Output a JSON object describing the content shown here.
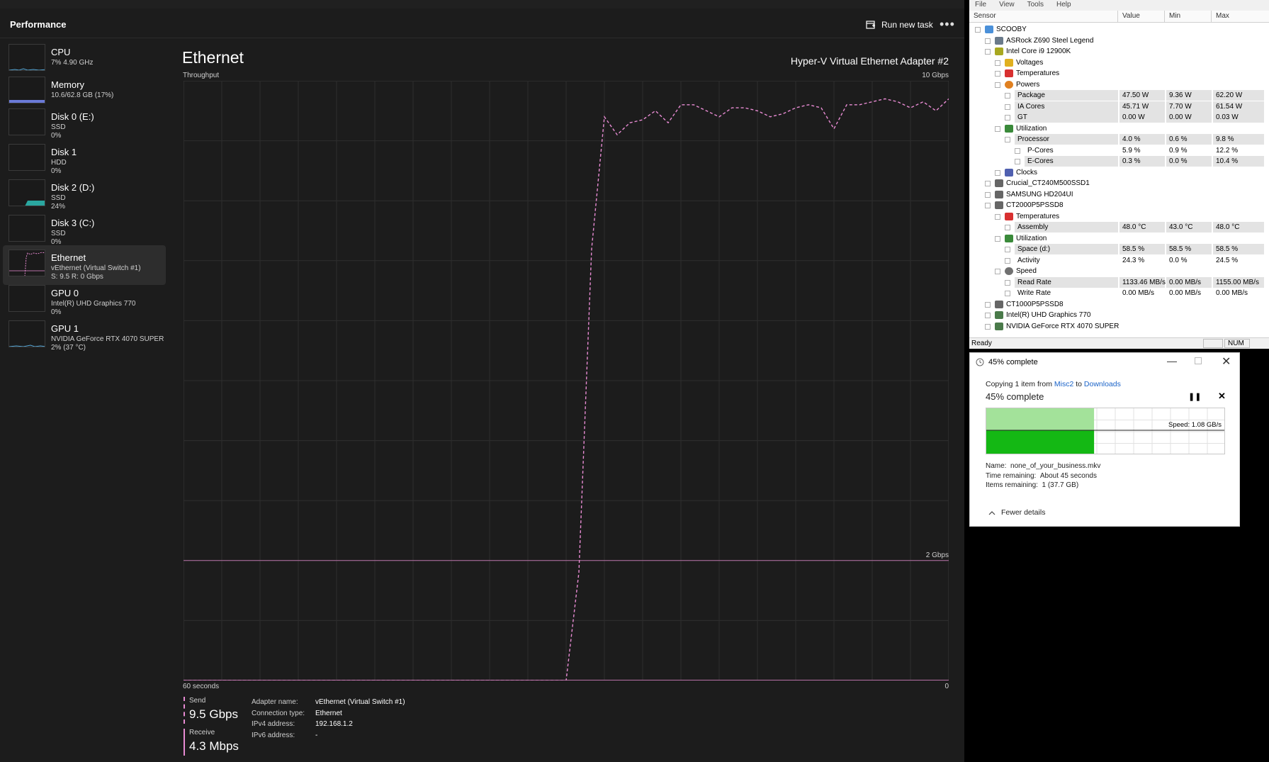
{
  "taskmgr": {
    "title": "Performance",
    "run_new_task": "Run new task",
    "more": "•••",
    "sidebar": [
      {
        "name": "CPU",
        "sub1": "7% 4.90 GHz",
        "sub2": ""
      },
      {
        "name": "Memory",
        "sub1": "10.6/62.8 GB (17%)",
        "sub2": ""
      },
      {
        "name": "Disk 0 (E:)",
        "sub1": "SSD",
        "sub2": "0%"
      },
      {
        "name": "Disk 1",
        "sub1": "HDD",
        "sub2": "0%"
      },
      {
        "name": "Disk 2 (D:)",
        "sub1": "SSD",
        "sub2": "24%"
      },
      {
        "name": "Disk 3 (C:)",
        "sub1": "SSD",
        "sub2": "0%"
      },
      {
        "name": "Ethernet",
        "sub1": "vEthernet (Virtual Switch #1)",
        "sub2": "S: 9.5 R: 0 Gbps"
      },
      {
        "name": "GPU 0",
        "sub1": "Intel(R) UHD Graphics 770",
        "sub2": "0%"
      },
      {
        "name": "GPU 1",
        "sub1": "NVIDIA GeForce RTX 4070 SUPER",
        "sub2": "2% (37 °C)"
      }
    ],
    "main_title": "Ethernet",
    "adapter": "Hyper-V Virtual Ethernet Adapter #2",
    "throughput_label": "Throughput",
    "scale_top": "10 Gbps",
    "scale_mid": "2 Gbps",
    "time_label": "60 seconds",
    "time_end": "0",
    "send_label": "Send",
    "send_value": "9.5 Gbps",
    "receive_label": "Receive",
    "receive_value": "4.3 Mbps",
    "details": [
      {
        "k": "Adapter name:",
        "v": "vEthernet (Virtual Switch #1)"
      },
      {
        "k": "Connection type:",
        "v": "Ethernet"
      },
      {
        "k": "IPv4 address:",
        "v": "192.168.1.2"
      },
      {
        "k": "IPv6 address:",
        "v": "-"
      }
    ],
    "accent_color": "#e88bd3"
  },
  "chart_data": {
    "type": "line",
    "title": "Throughput",
    "xlabel": "60 seconds",
    "ylabel": "",
    "ylim": [
      0,
      10
    ],
    "x": [
      60,
      59,
      58,
      57,
      56,
      55,
      54,
      53,
      52,
      51,
      50,
      49,
      48,
      47,
      46,
      45,
      44,
      43,
      42,
      41,
      40,
      39,
      38,
      37,
      36,
      35,
      34,
      33,
      32,
      31,
      30,
      29,
      28,
      27,
      26,
      25,
      24,
      23,
      22,
      21,
      20,
      19,
      18,
      17,
      16,
      15,
      14,
      13,
      12,
      11,
      10,
      9,
      8,
      7,
      6,
      5,
      4,
      3,
      2,
      1,
      0
    ],
    "series": [
      {
        "name": "Send",
        "style": "dashed",
        "values": [
          0,
          0,
          0,
          0,
          0,
          0,
          0,
          0,
          0,
          0,
          0,
          0,
          0,
          0,
          0,
          0,
          0,
          0,
          0,
          0,
          0,
          0,
          0,
          0,
          0,
          0,
          0,
          0,
          0,
          0,
          0,
          1.8,
          7.2,
          9.4,
          9.1,
          9.3,
          9.35,
          9.5,
          9.3,
          9.6,
          9.6,
          9.5,
          9.4,
          9.55,
          9.55,
          9.5,
          9.4,
          9.45,
          9.55,
          9.6,
          9.55,
          9.2,
          9.6,
          9.6,
          9.65,
          9.7,
          9.65,
          9.55,
          9.65,
          9.5,
          9.7
        ]
      },
      {
        "name": "Receive",
        "style": "solid",
        "values": [
          0,
          0,
          0,
          0,
          0,
          0,
          0,
          0,
          0,
          0,
          0,
          0,
          0,
          0,
          0,
          0,
          0,
          0,
          0,
          0,
          0,
          0,
          0,
          0,
          0,
          0,
          0,
          0,
          0,
          0,
          0,
          0,
          0,
          0,
          0,
          0,
          0,
          0,
          0,
          0,
          0,
          0,
          0,
          0,
          0,
          0,
          0,
          0,
          0,
          0,
          0,
          0,
          0,
          0,
          0,
          0,
          0,
          0,
          0,
          0,
          0
        ]
      }
    ],
    "reference_line": 2,
    "grid": true
  },
  "hwinfo": {
    "menu": [
      "File",
      "View",
      "Tools",
      "Help"
    ],
    "columns": [
      "Sensor",
      "Value",
      "Min",
      "Max"
    ],
    "rows": [
      {
        "level": 0,
        "icon": "computer-icon",
        "label": "SCOOBY",
        "v": "",
        "min": "",
        "max": "",
        "hl": false
      },
      {
        "level": 1,
        "icon": "motherboard-icon",
        "label": "ASRock Z690 Steel Legend",
        "v": "",
        "min": "",
        "max": "",
        "hl": false
      },
      {
        "level": 1,
        "icon": "cpu-icon",
        "label": "Intel Core i9 12900K",
        "v": "",
        "min": "",
        "max": "",
        "hl": false
      },
      {
        "level": 2,
        "icon": "voltage-icon",
        "label": "Voltages",
        "v": "",
        "min": "",
        "max": "",
        "hl": false
      },
      {
        "level": 2,
        "icon": "thermometer-icon",
        "label": "Temperatures",
        "v": "",
        "min": "",
        "max": "",
        "hl": false
      },
      {
        "level": 2,
        "icon": "flame-icon",
        "label": "Powers",
        "v": "",
        "min": "",
        "max": "",
        "hl": false
      },
      {
        "level": 3,
        "icon": "",
        "label": "Package",
        "v": "47.50 W",
        "min": "9.36 W",
        "max": "62.20 W",
        "hl": true
      },
      {
        "level": 3,
        "icon": "",
        "label": "IA Cores",
        "v": "45.71 W",
        "min": "7.70 W",
        "max": "61.54 W",
        "hl": true
      },
      {
        "level": 3,
        "icon": "",
        "label": "GT",
        "v": "0.00 W",
        "min": "0.00 W",
        "max": "0.03 W",
        "hl": true
      },
      {
        "level": 2,
        "icon": "utilization-icon",
        "label": "Utilization",
        "v": "",
        "min": "",
        "max": "",
        "hl": false
      },
      {
        "level": 3,
        "icon": "",
        "label": "Processor",
        "v": "4.0 %",
        "min": "0.6 %",
        "max": "9.8 %",
        "hl": true
      },
      {
        "level": 4,
        "icon": "",
        "label": "P-Cores",
        "v": "5.9 %",
        "min": "0.9 %",
        "max": "12.2 %",
        "hl": false
      },
      {
        "level": 4,
        "icon": "",
        "label": "E-Cores",
        "v": "0.3 %",
        "min": "0.0 %",
        "max": "10.4 %",
        "hl": true
      },
      {
        "level": 2,
        "icon": "clock-icon",
        "label": "Clocks",
        "v": "",
        "min": "",
        "max": "",
        "hl": false
      },
      {
        "level": 1,
        "icon": "drive-icon",
        "label": "Crucial_CT240M500SSD1",
        "v": "",
        "min": "",
        "max": "",
        "hl": false
      },
      {
        "level": 1,
        "icon": "drive-icon",
        "label": "SAMSUNG HD204UI",
        "v": "",
        "min": "",
        "max": "",
        "hl": false
      },
      {
        "level": 1,
        "icon": "drive-icon",
        "label": "CT2000P5PSSD8",
        "v": "",
        "min": "",
        "max": "",
        "hl": false
      },
      {
        "level": 2,
        "icon": "thermometer-icon",
        "label": "Temperatures",
        "v": "",
        "min": "",
        "max": "",
        "hl": false
      },
      {
        "level": 3,
        "icon": "",
        "label": "Assembly",
        "v": "48.0 °C",
        "min": "43.0 °C",
        "max": "48.0 °C",
        "hl": true
      },
      {
        "level": 2,
        "icon": "utilization-icon",
        "label": "Utilization",
        "v": "",
        "min": "",
        "max": "",
        "hl": false
      },
      {
        "level": 3,
        "icon": "",
        "label": "Space (d:)",
        "v": "58.5 %",
        "min": "58.5 %",
        "max": "58.5 %",
        "hl": true
      },
      {
        "level": 3,
        "icon": "",
        "label": "Activity",
        "v": "24.3 %",
        "min": "0.0 %",
        "max": "24.5 %",
        "hl": false
      },
      {
        "level": 2,
        "icon": "speed-icon",
        "label": "Speed",
        "v": "",
        "min": "",
        "max": "",
        "hl": false
      },
      {
        "level": 3,
        "icon": "",
        "label": "Read Rate",
        "v": "1133.46 MB/s",
        "min": "0.00 MB/s",
        "max": "1155.00 MB/s",
        "hl": true
      },
      {
        "level": 3,
        "icon": "",
        "label": "Write Rate",
        "v": "0.00 MB/s",
        "min": "0.00 MB/s",
        "max": "0.00 MB/s",
        "hl": false
      },
      {
        "level": 1,
        "icon": "drive-icon",
        "label": "CT1000P5PSSD8",
        "v": "",
        "min": "",
        "max": "",
        "hl": false
      },
      {
        "level": 1,
        "icon": "gpu-icon",
        "label": "Intel(R) UHD Graphics 770",
        "v": "",
        "min": "",
        "max": "",
        "hl": false
      },
      {
        "level": 1,
        "icon": "gpu-icon",
        "label": "NVIDIA GeForce RTX 4070 SUPER",
        "v": "",
        "min": "",
        "max": "",
        "hl": false
      }
    ],
    "status": "Ready",
    "num": "NUM"
  },
  "copy_dialog": {
    "title": "45% complete",
    "line_prefix": "Copying 1 item from ",
    "source": "Misc2",
    "line_mid": " to ",
    "dest": "Downloads",
    "percent_text": "45% complete",
    "progress": 0.45,
    "speed": "Speed: 1.08 GB/s",
    "name_label": "Name:",
    "name_value": "none_of_your_business.mkv",
    "time_label": "Time remaining:",
    "time_value": "About 45 seconds",
    "items_label": "Items remaining:",
    "items_value": "1 (37.7 GB)",
    "fewer_details": "Fewer details"
  }
}
